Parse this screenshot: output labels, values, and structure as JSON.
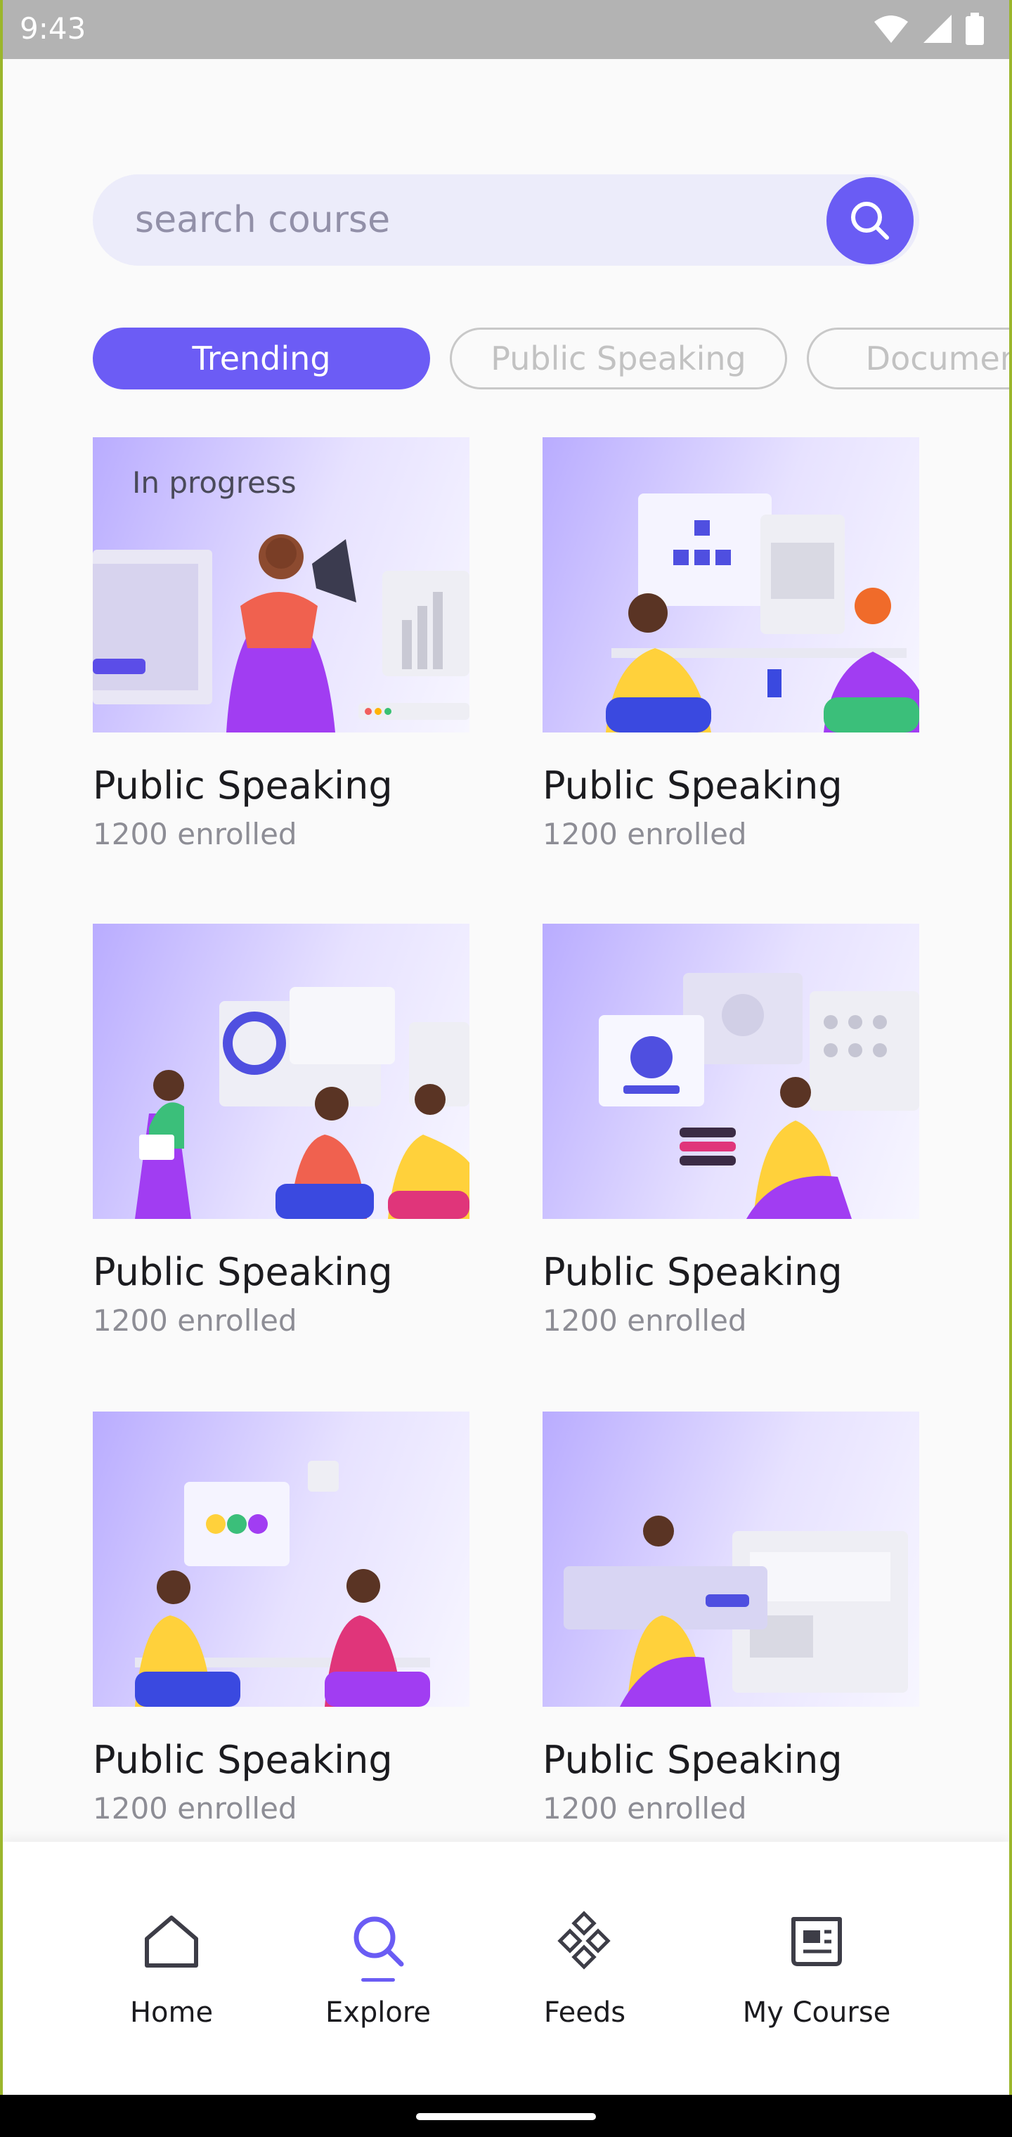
{
  "status_bar": {
    "time": "9:43"
  },
  "search": {
    "placeholder": "search course"
  },
  "chips": [
    {
      "label": "Trending",
      "active": true
    },
    {
      "label": "Public Speaking",
      "active": false
    },
    {
      "label": "Documentary",
      "active": false
    }
  ],
  "courses": [
    {
      "title": "Public Speaking",
      "enrolled": "1200 enrolled",
      "badge": "In progress"
    },
    {
      "title": "Public Speaking",
      "enrolled": "1200 enrolled"
    },
    {
      "title": "Public Speaking",
      "enrolled": "1200 enrolled"
    },
    {
      "title": "Public Speaking",
      "enrolled": "1200 enrolled"
    },
    {
      "title": "Public Speaking",
      "enrolled": "1200 enrolled"
    },
    {
      "title": "Public Speaking",
      "enrolled": "1200 enrolled"
    }
  ],
  "bottom_nav": {
    "items": [
      {
        "label": "Home",
        "icon": "home-icon"
      },
      {
        "label": "Explore",
        "icon": "search-icon",
        "active": true
      },
      {
        "label": "Feeds",
        "icon": "feeds-icon"
      },
      {
        "label": "My Course",
        "icon": "my-course-icon"
      }
    ]
  },
  "colors": {
    "accent": "#6a5cf4",
    "chip_active": "#6c5cf5",
    "search_bg": "#ececfa",
    "background": "#fafafa",
    "frame": "#9bb62c"
  }
}
